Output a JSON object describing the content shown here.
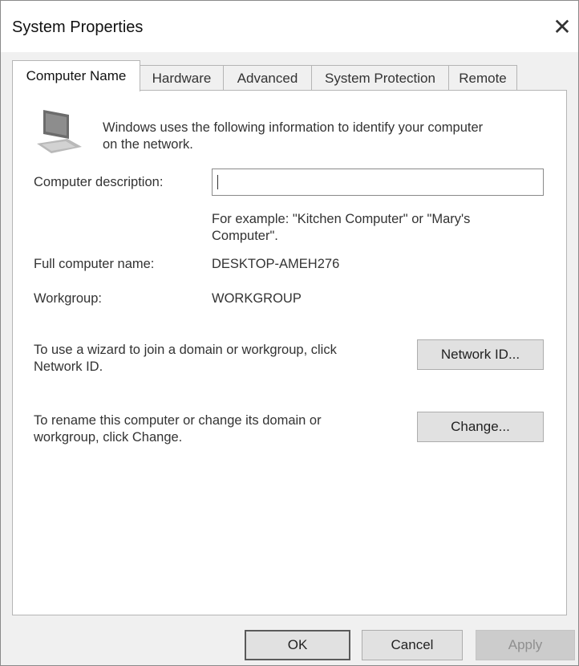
{
  "window": {
    "title": "System Properties",
    "close_glyph": "✕"
  },
  "tabs": [
    {
      "label": "Computer Name",
      "active": true
    },
    {
      "label": "Hardware",
      "active": false
    },
    {
      "label": "Advanced",
      "active": false
    },
    {
      "label": "System Protection",
      "active": false
    },
    {
      "label": "Remote",
      "active": false
    }
  ],
  "intro": {
    "icon": "computer-icon",
    "line1": "Windows uses the following information to identify your computer",
    "line2": "on the network."
  },
  "description": {
    "label": "Computer description:",
    "value": "",
    "hint_line1": "For example: \"Kitchen Computer\" or \"Mary's",
    "hint_line2": "Computer\"."
  },
  "full_name": {
    "label": "Full computer name:",
    "value": "DESKTOP-AMEH276"
  },
  "workgroup": {
    "label": "Workgroup:",
    "value": "WORKGROUP"
  },
  "network_id": {
    "text_line1": "To use a wizard to join a domain or workgroup, click",
    "text_line2": "Network ID.",
    "button": "Network ID..."
  },
  "change": {
    "text_line1": "To rename this computer or change its domain or",
    "text_line2": "workgroup, click Change.",
    "button": "Change..."
  },
  "footer": {
    "ok": "OK",
    "cancel": "Cancel",
    "apply": "Apply"
  }
}
